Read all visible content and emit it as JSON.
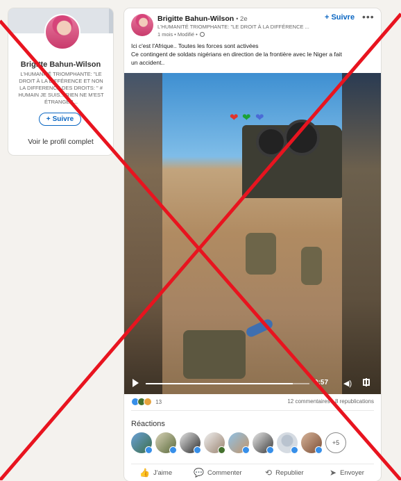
{
  "profile": {
    "name": "Brigitte Bahun-Wilson",
    "headline": "L'HUMANITÉ TRIOMPHANTE: \"LE DROIT À LA DIFFÉRENCE ET NON LA DIFFERENCE DES DROITS: \" # HUMAIN JE SUIS... RIEN NE M'EST ÉTRANGER...",
    "follow_label": "Suivre",
    "view_profile_label": "Voir le profil complet"
  },
  "post": {
    "author": "Brigitte Bahun-Wilson",
    "degree": "• 2e",
    "headline": "L'HUMANITÉ TRIOMPHANTE: \"LE DROIT À LA DIFFÉRENCE ...",
    "meta": "1 mois • Modifié •",
    "follow_label": "Suivre",
    "more_label": "•••",
    "text_lines": [
      "Ici c'est l'Afrique.. Toutes les forces sont activées",
      "Ce contingent de soldats nigérians en direction de la frontière avec le Niger a fait",
      "un accident.."
    ]
  },
  "video": {
    "time": "0:57",
    "progress": 0.9,
    "hearts": [
      "❤",
      "❤",
      "❤"
    ]
  },
  "social": {
    "reaction_count": "13",
    "comments_reposts": "12 commentaires • 8 republications"
  },
  "reactions": {
    "title": "Réactions",
    "more_label": "+5"
  },
  "actions": {
    "like": "J'aime",
    "comment": "Commenter",
    "repost": "Republier",
    "send": "Envoyer"
  },
  "colors": {
    "brand": "#0a66c2",
    "overlay_x": "#e8141f"
  }
}
